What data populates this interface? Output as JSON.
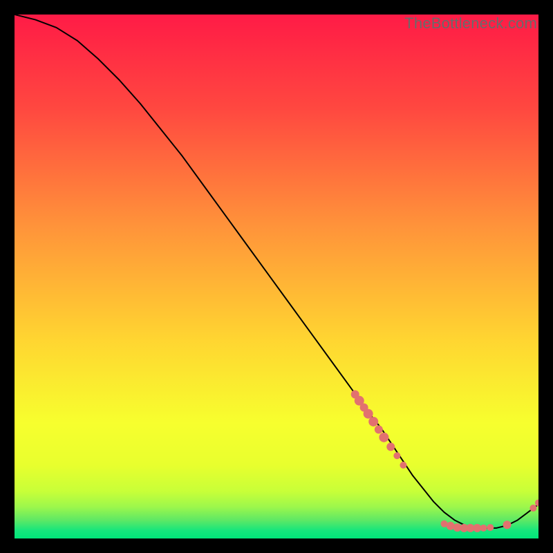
{
  "watermark": "TheBottleneck.com",
  "colors": {
    "gradient_top": "#ff1b46",
    "gradient_mid_upper": "#ff7a3c",
    "gradient_mid": "#ffd531",
    "gradient_mid_lower": "#f7ff2e",
    "gradient_bottom": "#00e57a",
    "curve": "#000000",
    "marker": "#e2716f"
  },
  "chart_data": {
    "type": "line",
    "title": "",
    "xlabel": "",
    "ylabel": "",
    "xlim": [
      0,
      100
    ],
    "ylim": [
      0,
      100
    ],
    "grid": false,
    "legend": false,
    "series": [
      {
        "name": "bottleneck-curve",
        "x": [
          0,
          4,
          8,
          12,
          16,
          20,
          24,
          28,
          32,
          36,
          40,
          44,
          48,
          52,
          56,
          60,
          64,
          68,
          70,
          72,
          74,
          76,
          78,
          80,
          82,
          84,
          86,
          88,
          90,
          92,
          94,
          96,
          98,
          100
        ],
        "y": [
          100,
          99,
          97.5,
          95,
          91.5,
          87.5,
          83,
          78,
          73,
          67.5,
          62,
          56.5,
          51,
          45.5,
          40,
          34.5,
          29,
          23.5,
          21,
          18,
          15,
          12,
          9.5,
          7,
          5,
          3.5,
          2.5,
          2,
          2,
          2,
          2.5,
          3.5,
          5,
          6.5
        ]
      }
    ],
    "markers": [
      {
        "name": "cluster-descent",
        "points": [
          {
            "x": 65.0,
            "y": 27.5,
            "r": 6
          },
          {
            "x": 65.8,
            "y": 26.3,
            "r": 7
          },
          {
            "x": 66.7,
            "y": 25.0,
            "r": 6
          },
          {
            "x": 67.5,
            "y": 23.8,
            "r": 7
          },
          {
            "x": 68.5,
            "y": 22.3,
            "r": 7
          },
          {
            "x": 69.5,
            "y": 20.8,
            "r": 6
          },
          {
            "x": 70.5,
            "y": 19.3,
            "r": 7
          },
          {
            "x": 71.8,
            "y": 17.5,
            "r": 6
          },
          {
            "x": 73.0,
            "y": 15.8,
            "r": 5
          },
          {
            "x": 74.2,
            "y": 14.0,
            "r": 5
          }
        ]
      },
      {
        "name": "cluster-trough",
        "points": [
          {
            "x": 82.0,
            "y": 2.8,
            "r": 5
          },
          {
            "x": 83.2,
            "y": 2.4,
            "r": 6
          },
          {
            "x": 84.5,
            "y": 2.1,
            "r": 6
          },
          {
            "x": 85.8,
            "y": 2.0,
            "r": 6
          },
          {
            "x": 87.0,
            "y": 2.0,
            "r": 6
          },
          {
            "x": 88.3,
            "y": 2.0,
            "r": 6
          },
          {
            "x": 89.5,
            "y": 2.0,
            "r": 5
          },
          {
            "x": 90.8,
            "y": 2.1,
            "r": 5
          },
          {
            "x": 94.0,
            "y": 2.6,
            "r": 6
          }
        ]
      },
      {
        "name": "cluster-rise",
        "points": [
          {
            "x": 99.0,
            "y": 5.8,
            "r": 5
          },
          {
            "x": 100.0,
            "y": 6.8,
            "r": 5
          }
        ]
      }
    ]
  }
}
